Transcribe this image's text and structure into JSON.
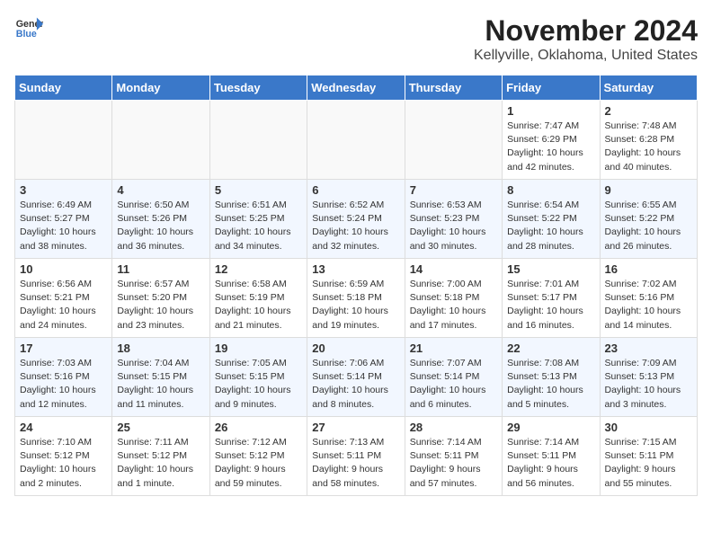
{
  "header": {
    "logo_line1": "General",
    "logo_line2": "Blue",
    "month": "November 2024",
    "location": "Kellyville, Oklahoma, United States"
  },
  "weekdays": [
    "Sunday",
    "Monday",
    "Tuesday",
    "Wednesday",
    "Thursday",
    "Friday",
    "Saturday"
  ],
  "weeks": [
    [
      {
        "day": "",
        "info": ""
      },
      {
        "day": "",
        "info": ""
      },
      {
        "day": "",
        "info": ""
      },
      {
        "day": "",
        "info": ""
      },
      {
        "day": "",
        "info": ""
      },
      {
        "day": "1",
        "info": "Sunrise: 7:47 AM\nSunset: 6:29 PM\nDaylight: 10 hours\nand 42 minutes."
      },
      {
        "day": "2",
        "info": "Sunrise: 7:48 AM\nSunset: 6:28 PM\nDaylight: 10 hours\nand 40 minutes."
      }
    ],
    [
      {
        "day": "3",
        "info": "Sunrise: 6:49 AM\nSunset: 5:27 PM\nDaylight: 10 hours\nand 38 minutes."
      },
      {
        "day": "4",
        "info": "Sunrise: 6:50 AM\nSunset: 5:26 PM\nDaylight: 10 hours\nand 36 minutes."
      },
      {
        "day": "5",
        "info": "Sunrise: 6:51 AM\nSunset: 5:25 PM\nDaylight: 10 hours\nand 34 minutes."
      },
      {
        "day": "6",
        "info": "Sunrise: 6:52 AM\nSunset: 5:24 PM\nDaylight: 10 hours\nand 32 minutes."
      },
      {
        "day": "7",
        "info": "Sunrise: 6:53 AM\nSunset: 5:23 PM\nDaylight: 10 hours\nand 30 minutes."
      },
      {
        "day": "8",
        "info": "Sunrise: 6:54 AM\nSunset: 5:22 PM\nDaylight: 10 hours\nand 28 minutes."
      },
      {
        "day": "9",
        "info": "Sunrise: 6:55 AM\nSunset: 5:22 PM\nDaylight: 10 hours\nand 26 minutes."
      }
    ],
    [
      {
        "day": "10",
        "info": "Sunrise: 6:56 AM\nSunset: 5:21 PM\nDaylight: 10 hours\nand 24 minutes."
      },
      {
        "day": "11",
        "info": "Sunrise: 6:57 AM\nSunset: 5:20 PM\nDaylight: 10 hours\nand 23 minutes."
      },
      {
        "day": "12",
        "info": "Sunrise: 6:58 AM\nSunset: 5:19 PM\nDaylight: 10 hours\nand 21 minutes."
      },
      {
        "day": "13",
        "info": "Sunrise: 6:59 AM\nSunset: 5:18 PM\nDaylight: 10 hours\nand 19 minutes."
      },
      {
        "day": "14",
        "info": "Sunrise: 7:00 AM\nSunset: 5:18 PM\nDaylight: 10 hours\nand 17 minutes."
      },
      {
        "day": "15",
        "info": "Sunrise: 7:01 AM\nSunset: 5:17 PM\nDaylight: 10 hours\nand 16 minutes."
      },
      {
        "day": "16",
        "info": "Sunrise: 7:02 AM\nSunset: 5:16 PM\nDaylight: 10 hours\nand 14 minutes."
      }
    ],
    [
      {
        "day": "17",
        "info": "Sunrise: 7:03 AM\nSunset: 5:16 PM\nDaylight: 10 hours\nand 12 minutes."
      },
      {
        "day": "18",
        "info": "Sunrise: 7:04 AM\nSunset: 5:15 PM\nDaylight: 10 hours\nand 11 minutes."
      },
      {
        "day": "19",
        "info": "Sunrise: 7:05 AM\nSunset: 5:15 PM\nDaylight: 10 hours\nand 9 minutes."
      },
      {
        "day": "20",
        "info": "Sunrise: 7:06 AM\nSunset: 5:14 PM\nDaylight: 10 hours\nand 8 minutes."
      },
      {
        "day": "21",
        "info": "Sunrise: 7:07 AM\nSunset: 5:14 PM\nDaylight: 10 hours\nand 6 minutes."
      },
      {
        "day": "22",
        "info": "Sunrise: 7:08 AM\nSunset: 5:13 PM\nDaylight: 10 hours\nand 5 minutes."
      },
      {
        "day": "23",
        "info": "Sunrise: 7:09 AM\nSunset: 5:13 PM\nDaylight: 10 hours\nand 3 minutes."
      }
    ],
    [
      {
        "day": "24",
        "info": "Sunrise: 7:10 AM\nSunset: 5:12 PM\nDaylight: 10 hours\nand 2 minutes."
      },
      {
        "day": "25",
        "info": "Sunrise: 7:11 AM\nSunset: 5:12 PM\nDaylight: 10 hours\nand 1 minute."
      },
      {
        "day": "26",
        "info": "Sunrise: 7:12 AM\nSunset: 5:12 PM\nDaylight: 9 hours\nand 59 minutes."
      },
      {
        "day": "27",
        "info": "Sunrise: 7:13 AM\nSunset: 5:11 PM\nDaylight: 9 hours\nand 58 minutes."
      },
      {
        "day": "28",
        "info": "Sunrise: 7:14 AM\nSunset: 5:11 PM\nDaylight: 9 hours\nand 57 minutes."
      },
      {
        "day": "29",
        "info": "Sunrise: 7:14 AM\nSunset: 5:11 PM\nDaylight: 9 hours\nand 56 minutes."
      },
      {
        "day": "30",
        "info": "Sunrise: 7:15 AM\nSunset: 5:11 PM\nDaylight: 9 hours\nand 55 minutes."
      }
    ]
  ]
}
